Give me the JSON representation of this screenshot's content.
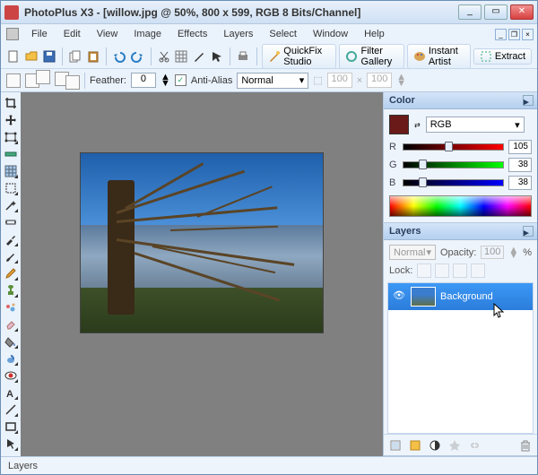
{
  "title": "PhotoPlus X3 - [willow.jpg @ 50%, 800 x 599, RGB 8 Bits/Channel]",
  "menus": [
    "File",
    "Edit",
    "View",
    "Image",
    "Effects",
    "Layers",
    "Select",
    "Window",
    "Help"
  ],
  "quickbuttons": {
    "quickfix": "QuickFix Studio",
    "filtergallery": "Filter Gallery",
    "instantartist": "Instant Artist",
    "extract": "Extract"
  },
  "options": {
    "feather_label": "Feather:",
    "feather_value": "0",
    "antialias_label": "Anti-Alias",
    "antialias_checked": "✓",
    "mode": "Normal",
    "width": "100",
    "height": "100"
  },
  "colorpanel": {
    "title": "Color",
    "mode": "RGB",
    "r_label": "R",
    "r_val": "105",
    "g_label": "G",
    "g_val": "38",
    "b_label": "B",
    "b_val": "38"
  },
  "layerspanel": {
    "title": "Layers",
    "blendmode": "Normal",
    "opacity_label": "Opacity:",
    "opacity_val": "100",
    "opacity_unit": "%",
    "lock_label": "Lock:",
    "layer_name": "Background"
  },
  "status": "Layers"
}
